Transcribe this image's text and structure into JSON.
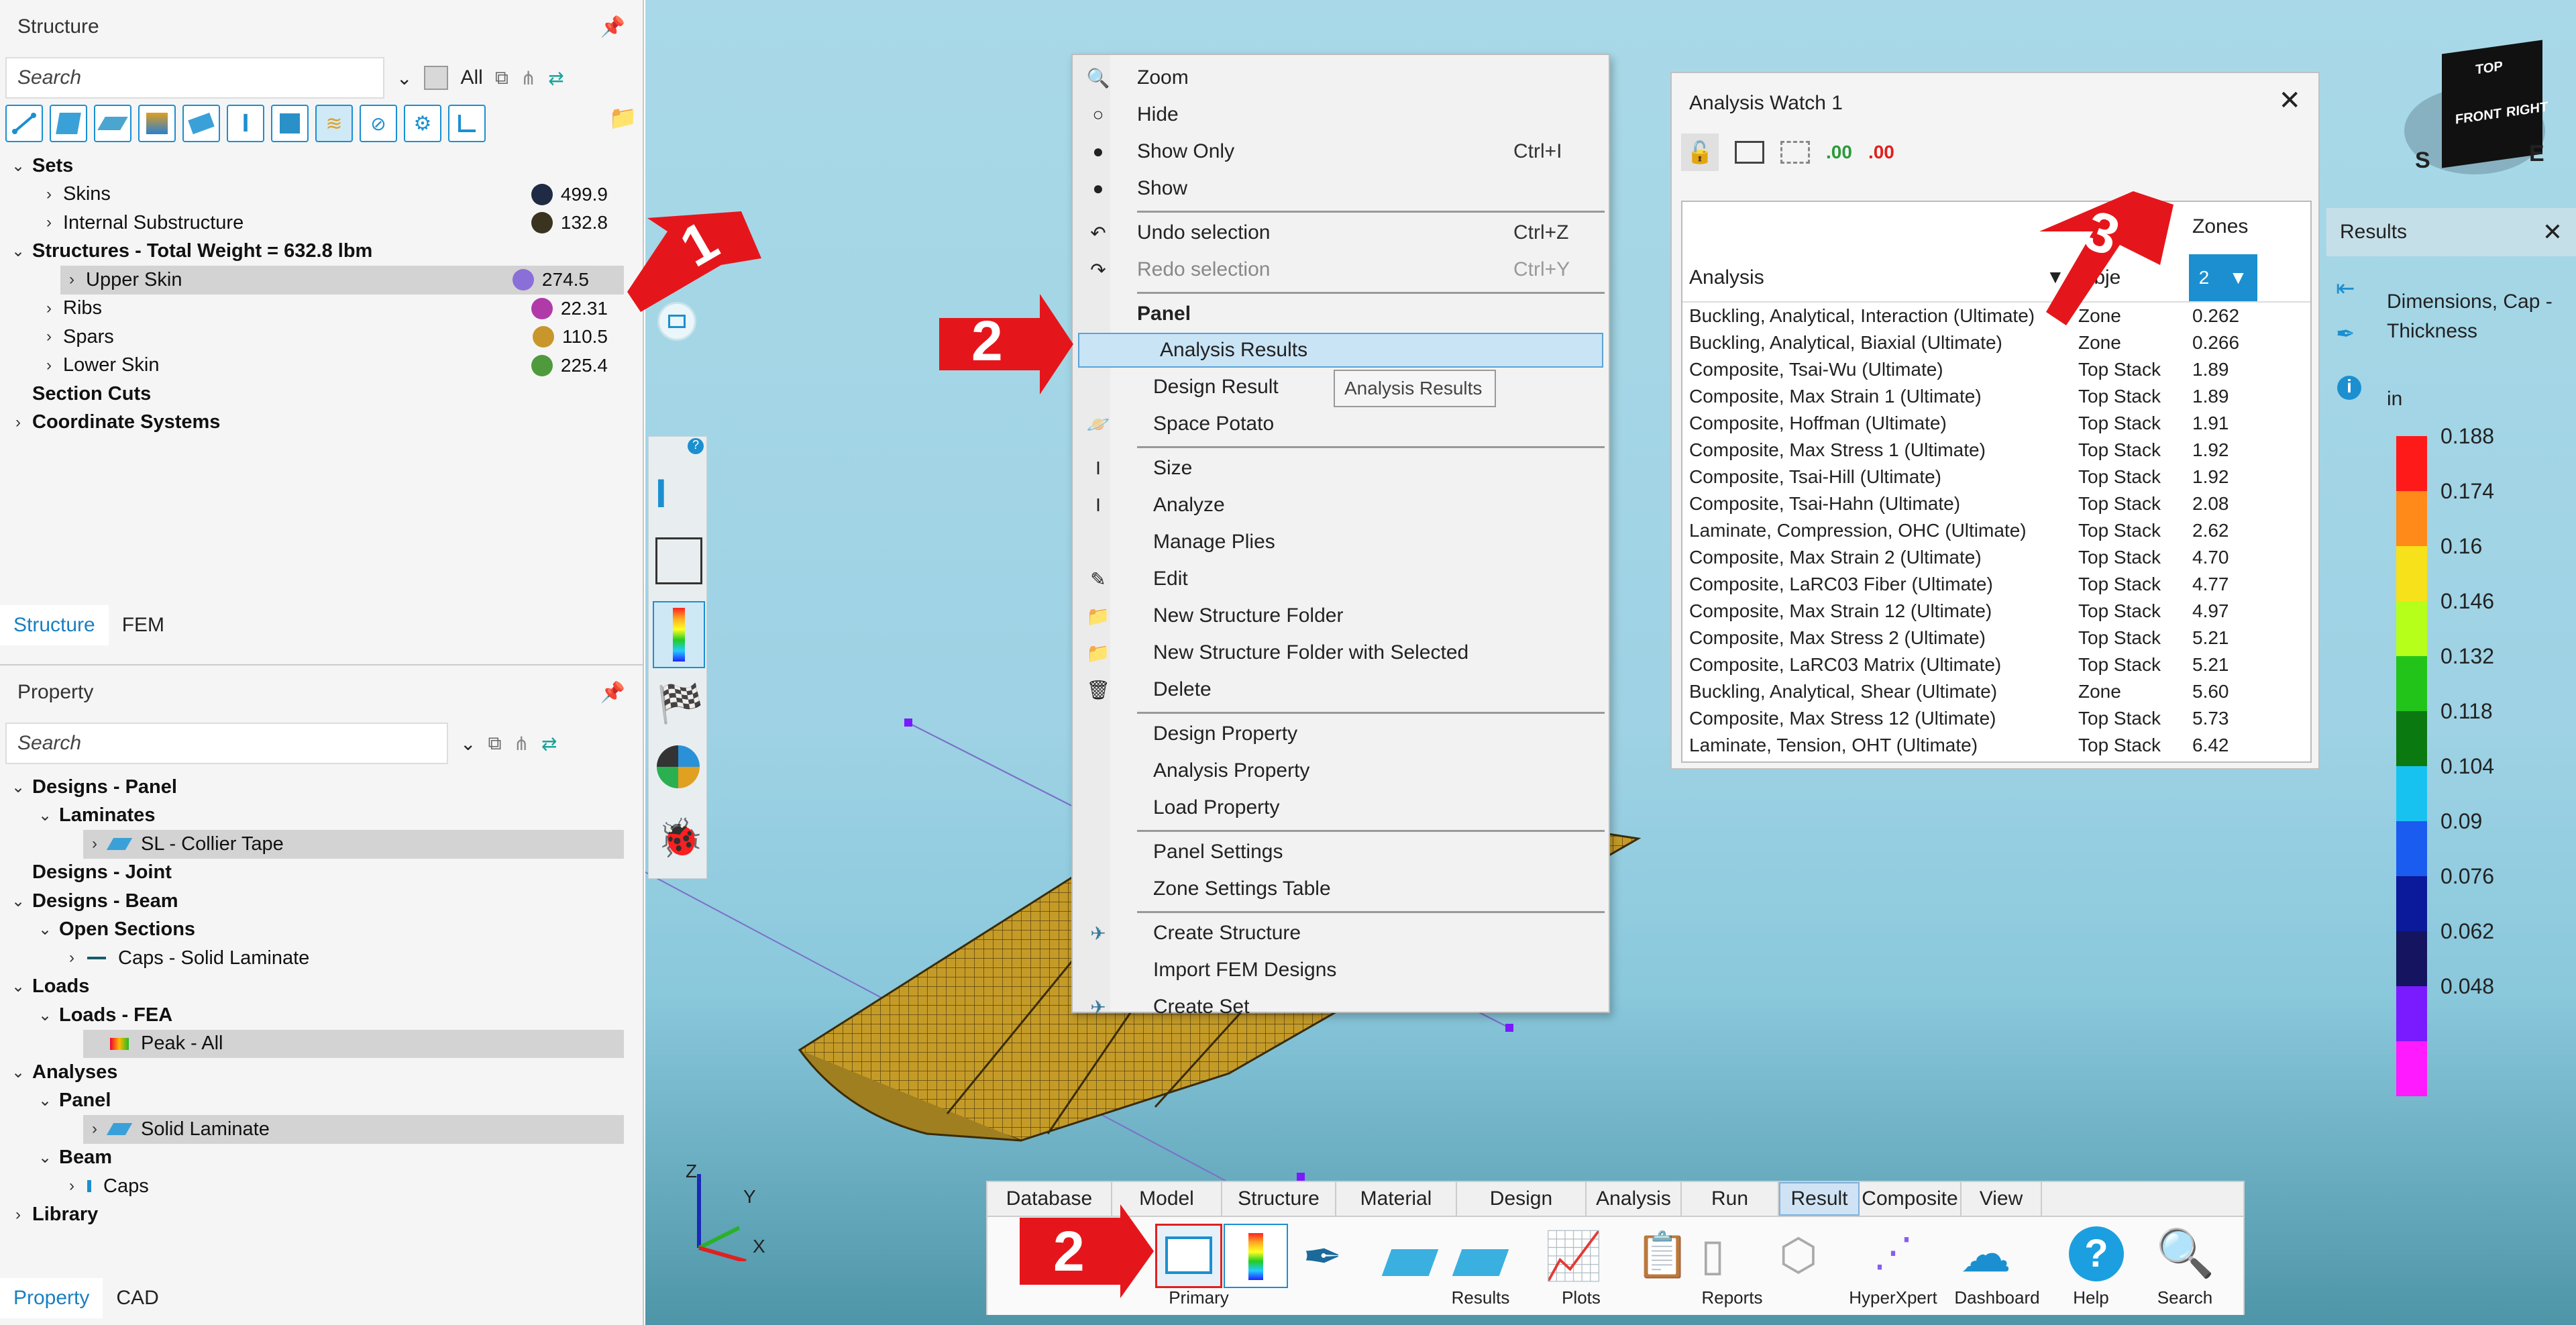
{
  "structure_panel": {
    "title": "Structure",
    "search_placeholder": "Search",
    "all_label": "All",
    "tree": [
      {
        "label": "Sets",
        "bold": true,
        "level": 0,
        "chev": "v"
      },
      {
        "label": "Skins",
        "level": 1,
        "chev": ">",
        "value": "499.9",
        "color": "#1f2a44"
      },
      {
        "label": "Internal Substructure",
        "level": 1,
        "chev": ">",
        "value": "132.8",
        "color": "#3a3320"
      },
      {
        "label": "Structures - Total Weight = 632.8 lbm",
        "bold": true,
        "level": 0,
        "chev": "v"
      },
      {
        "label": "Upper Skin",
        "level": 1,
        "chev": ">",
        "value": "274.5",
        "color": "#8a6fd8",
        "selected": true
      },
      {
        "label": "Ribs",
        "level": 1,
        "chev": ">",
        "value": "22.31",
        "color": "#b03aa8"
      },
      {
        "label": "Spars",
        "level": 1,
        "chev": ">",
        "value": "110.5",
        "color": "#c9962b"
      },
      {
        "label": "Lower Skin",
        "level": 1,
        "chev": ">",
        "value": "225.4",
        "color": "#4e9a3c"
      },
      {
        "label": "Section Cuts",
        "bold": true,
        "level": 0,
        "chev": ""
      },
      {
        "label": "Coordinate Systems",
        "bold": true,
        "level": 0,
        "chev": ">"
      }
    ],
    "tabs": [
      "Structure",
      "FEM"
    ]
  },
  "property_panel": {
    "title": "Property",
    "search_placeholder": "Search",
    "tree": [
      {
        "label": "Designs - Panel",
        "bold": true,
        "level": 0,
        "chev": "v"
      },
      {
        "label": "Laminates",
        "bold": true,
        "level": 1,
        "chev": "v"
      },
      {
        "label": "SL - Collier Tape",
        "level": 2,
        "chev": ">",
        "selected": true,
        "icon": "laminate"
      },
      {
        "label": "Designs - Joint",
        "bold": true,
        "level": 0,
        "chev": ""
      },
      {
        "label": "Designs - Beam",
        "bold": true,
        "level": 0,
        "chev": "v"
      },
      {
        "label": "Open Sections",
        "bold": true,
        "level": 1,
        "chev": "v"
      },
      {
        "label": "Caps - Solid Laminate",
        "level": 2,
        "chev": ">",
        "icon": "cap"
      },
      {
        "label": "Loads",
        "bold": true,
        "level": 0,
        "chev": "v"
      },
      {
        "label": "Loads - FEA",
        "bold": true,
        "level": 1,
        "chev": "v"
      },
      {
        "label": "Peak - All",
        "level": 2,
        "chev": "",
        "selected": true,
        "icon": "load"
      },
      {
        "label": "Analyses",
        "bold": true,
        "level": 0,
        "chev": "v"
      },
      {
        "label": "Panel",
        "bold": true,
        "level": 1,
        "chev": "v"
      },
      {
        "label": "Solid Laminate",
        "level": 2,
        "chev": ">",
        "selected": true,
        "icon": "laminate"
      },
      {
        "label": "Beam",
        "bold": true,
        "level": 1,
        "chev": "v"
      },
      {
        "label": "Caps",
        "level": 2,
        "chev": ">",
        "icon": "beam"
      },
      {
        "label": "Library",
        "bold": true,
        "level": 0,
        "chev": ">"
      }
    ],
    "tabs": [
      "Property",
      "CAD"
    ]
  },
  "context_menu": {
    "items": [
      {
        "label": "Zoom",
        "icon": "zoom-icon",
        "indent": false
      },
      {
        "label": "Hide",
        "icon": "hide-circle-icon",
        "indent": false
      },
      {
        "label": "Show Only",
        "icon": "show-only-icon",
        "shortcut": "Ctrl+I",
        "indent": false
      },
      {
        "label": "Show",
        "icon": "show-icon",
        "indent": false
      },
      {
        "sep": true
      },
      {
        "label": "Undo selection",
        "icon": "undo-icon",
        "shortcut": "Ctrl+Z",
        "indent": false
      },
      {
        "label": "Redo selection",
        "icon": "redo-icon",
        "shortcut": "Ctrl+Y",
        "indent": false,
        "disabled": true
      },
      {
        "sep": true
      },
      {
        "label": "Panel",
        "header": true
      },
      {
        "label": "Analysis Results",
        "indent": true,
        "highlight": true
      },
      {
        "label": "Design Result",
        "indent": true
      },
      {
        "label": "Space Potato",
        "icon": "potato-icon",
        "indent": true
      },
      {
        "sep": true
      },
      {
        "label": "Size",
        "icon": "size-icon",
        "indent": true
      },
      {
        "label": "Analyze",
        "icon": "analyze-icon",
        "indent": true
      },
      {
        "label": "Manage Plies",
        "indent": true
      },
      {
        "label": "Edit",
        "icon": "edit-icon",
        "indent": true
      },
      {
        "label": "New Structure Folder",
        "icon": "folder-icon",
        "indent": true
      },
      {
        "label": "New Structure Folder with Selected",
        "icon": "folder-add-icon",
        "indent": true
      },
      {
        "label": "Delete",
        "icon": "trash-icon",
        "indent": true
      },
      {
        "sep": true
      },
      {
        "label": "Design Property",
        "indent": true
      },
      {
        "label": "Analysis Property",
        "indent": true
      },
      {
        "label": "Load Property",
        "indent": true
      },
      {
        "sep": true
      },
      {
        "label": "Panel Settings",
        "indent": true
      },
      {
        "label": "Zone Settings Table",
        "indent": true
      },
      {
        "sep": true
      },
      {
        "label": "Create Structure",
        "icon": "plane-icon",
        "indent": true
      },
      {
        "label": "Import FEM Designs",
        "indent": true
      },
      {
        "label": "Create Set",
        "icon": "plane-icon",
        "indent": true
      }
    ],
    "tooltip": "Analysis Results"
  },
  "analysis_watch": {
    "title": "Analysis Watch 1",
    "col_analysis": "Analysis",
    "col_object": "Obje",
    "col_zones": "Zones",
    "zones_value": "2",
    "rows": [
      [
        "Buckling, Analytical, Interaction (Ultimate)",
        "Zone",
        "0.262"
      ],
      [
        "Buckling, Analytical, Biaxial (Ultimate)",
        "Zone",
        "0.266"
      ],
      [
        "Composite, Tsai-Wu (Ultimate)",
        "Top Stack",
        "1.89"
      ],
      [
        "Composite, Max Strain 1 (Ultimate)",
        "Top Stack",
        "1.89"
      ],
      [
        "Composite, Hoffman (Ultimate)",
        "Top Stack",
        "1.91"
      ],
      [
        "Composite, Max Stress 1 (Ultimate)",
        "Top Stack",
        "1.92"
      ],
      [
        "Composite, Tsai-Hill (Ultimate)",
        "Top Stack",
        "1.92"
      ],
      [
        "Composite, Tsai-Hahn (Ultimate)",
        "Top Stack",
        "2.08"
      ],
      [
        "Laminate, Compression, OHC (Ultimate)",
        "Top Stack",
        "2.62"
      ],
      [
        "Composite, Max Strain 2 (Ultimate)",
        "Top Stack",
        "4.70"
      ],
      [
        "Composite, LaRC03 Fiber (Ultimate)",
        "Top Stack",
        "4.77"
      ],
      [
        "Composite, Max Strain 12 (Ultimate)",
        "Top Stack",
        "4.97"
      ],
      [
        "Composite, Max Stress 2 (Ultimate)",
        "Top Stack",
        "5.21"
      ],
      [
        "Composite, LaRC03 Matrix (Ultimate)",
        "Top Stack",
        "5.21"
      ],
      [
        "Buckling, Analytical, Shear (Ultimate)",
        "Zone",
        "5.60"
      ],
      [
        "Composite, Max Stress 12 (Ultimate)",
        "Top Stack",
        "5.73"
      ],
      [
        "Laminate, Tension, OHT (Ultimate)",
        "Top Stack",
        "6.42"
      ]
    ]
  },
  "results_panel": {
    "title": "Results",
    "description": "Dimensions, Cap - Thickness",
    "unit": "in",
    "legend": [
      {
        "v": "0.188",
        "c": "#ff1a1a"
      },
      {
        "v": "0.174",
        "c": "#ff8a1a"
      },
      {
        "v": "0.16",
        "c": "#f7e11a"
      },
      {
        "v": "0.146",
        "c": "#b5ff1a"
      },
      {
        "v": "0.132",
        "c": "#22c41a"
      },
      {
        "v": "0.118",
        "c": "#0a7a10"
      },
      {
        "v": "0.104",
        "c": "#18c2f0"
      },
      {
        "v": "0.09",
        "c": "#1a5cf0"
      },
      {
        "v": "0.076",
        "c": "#0a1a9a"
      },
      {
        "v": "0.062",
        "c": "#141460"
      },
      {
        "v": "0.048",
        "c": "#7a1aff"
      },
      {
        "v": "",
        "c": "#ff1aff"
      }
    ]
  },
  "ribbon": {
    "tabs": [
      "Database",
      "Model",
      "Structure",
      "Material",
      "Design",
      "Analysis",
      "Run",
      "Result",
      "Composite",
      "View"
    ],
    "active": "Result",
    "groups": [
      "Primary",
      "Results",
      "Plots",
      "Reports",
      "HyperXpert",
      "Dashboard",
      "Help",
      "Search"
    ]
  },
  "annotations": [
    "1",
    "2",
    "2",
    "3"
  ],
  "viewcube": {
    "top": "TOP",
    "front": "FRONT",
    "right": "RIGHT",
    "compass": [
      "S",
      "E"
    ]
  },
  "axes": {
    "z": "Z",
    "y": "Y",
    "x": "X"
  }
}
